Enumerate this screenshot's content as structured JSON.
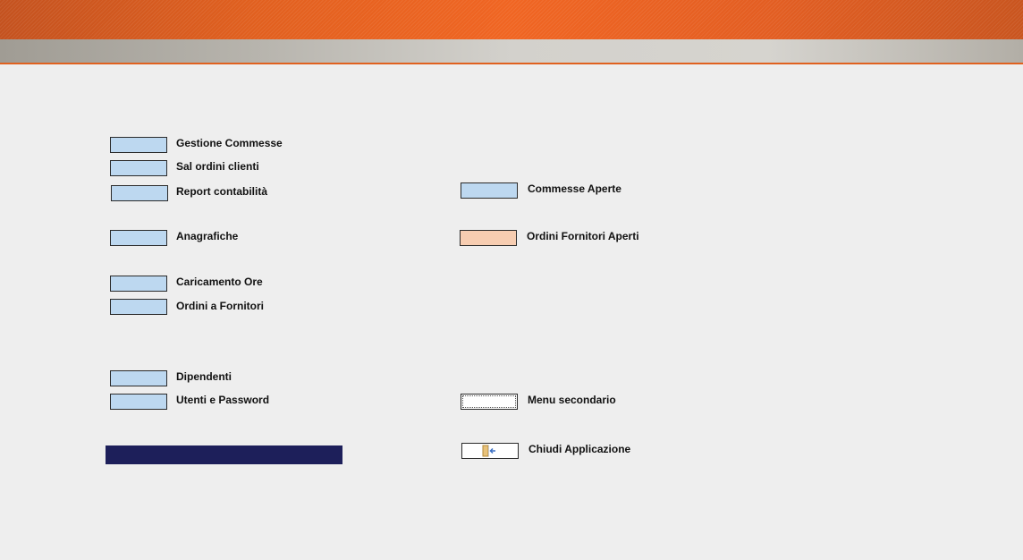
{
  "menu_left": {
    "items": [
      {
        "label": "Gestione Commesse"
      },
      {
        "label": "Sal ordini clienti"
      },
      {
        "label": "Report contabilità"
      },
      {
        "label": "Anagrafiche"
      },
      {
        "label": "Caricamento Ore"
      },
      {
        "label": "Ordini a Fornitori"
      },
      {
        "label": "Dipendenti"
      },
      {
        "label": "Utenti e Password"
      }
    ]
  },
  "menu_right": {
    "items": [
      {
        "label": "Commesse Aperte"
      },
      {
        "label": "Ordini Fornitori Aperti"
      },
      {
        "label": "Menu secondario"
      },
      {
        "label": "Chiudi Applicazione",
        "icon": "exit-door-icon"
      }
    ]
  },
  "colors": {
    "header_orange": "#f06522",
    "subheader_gray": "#c8c6c0",
    "button_blue": "#bdd8f0",
    "button_peach": "#f7cdb1",
    "navy_bar": "#1d1f5a",
    "background": "#eeeeee"
  }
}
